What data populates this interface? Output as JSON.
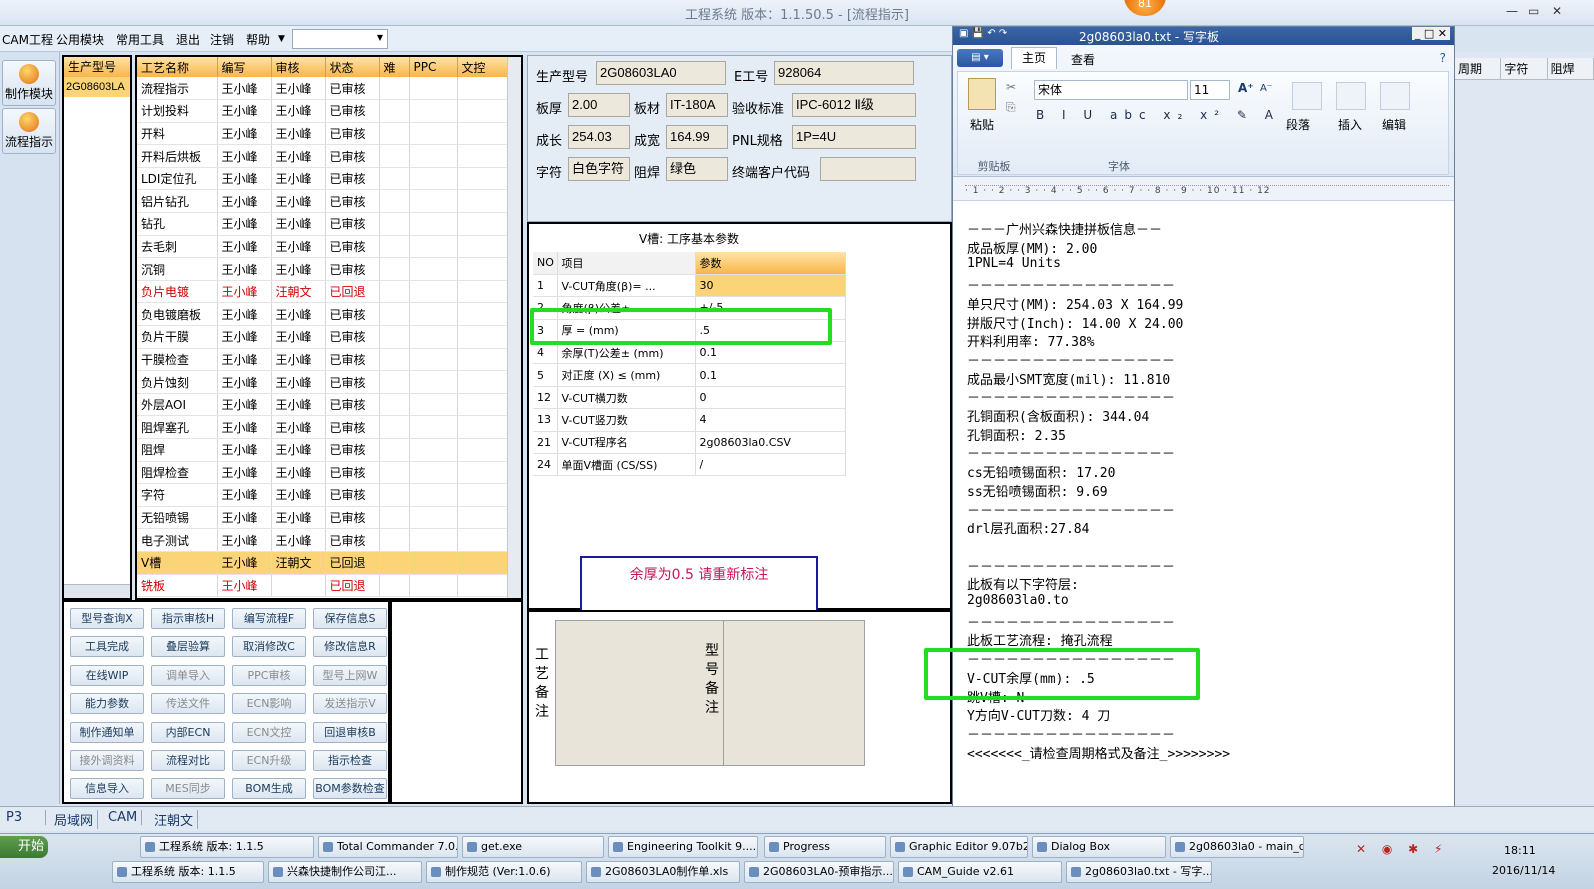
{
  "window": {
    "title": "工程系统   版本：1.1.50.5 - [流程指示]",
    "badge": "81"
  },
  "menu": [
    "CAM工程",
    "公用模块",
    "常用工具",
    "退出",
    "注销",
    "帮助"
  ],
  "leftbar": [
    {
      "label": "制作模块",
      "icon": "make-module-icon"
    },
    {
      "label": "流程指示",
      "icon": "flow-indicator-icon"
    }
  ],
  "model_panel": {
    "header": "生产型号",
    "value": "2G08603LA"
  },
  "process_table": {
    "headers": [
      "工艺名称",
      "编写",
      "审核",
      "状态",
      "难",
      "PPC",
      "文控"
    ],
    "rows": [
      [
        "流程指示",
        "王小峰",
        "王小峰",
        "已审核"
      ],
      [
        "计划投料",
        "王小峰",
        "王小峰",
        "已审核"
      ],
      [
        "开料",
        "王小峰",
        "王小峰",
        "已审核"
      ],
      [
        "开料后烘板",
        "王小峰",
        "王小峰",
        "已审核"
      ],
      [
        "LDI定位孔",
        "王小峰",
        "王小峰",
        "已审核"
      ],
      [
        "铝片钻孔",
        "王小峰",
        "王小峰",
        "已审核"
      ],
      [
        "钻孔",
        "王小峰",
        "王小峰",
        "已审核"
      ],
      [
        "去毛刺",
        "王小峰",
        "王小峰",
        "已审核"
      ],
      [
        "沉铜",
        "王小峰",
        "王小峰",
        "已审核"
      ],
      [
        "负片电镀",
        "王小峰",
        "汪朝文",
        "已回退"
      ],
      [
        "负电镀磨板",
        "王小峰",
        "王小峰",
        "已审核"
      ],
      [
        "负片干膜",
        "王小峰",
        "王小峰",
        "已审核"
      ],
      [
        "干膜检查",
        "王小峰",
        "王小峰",
        "已审核"
      ],
      [
        "负片蚀刻",
        "王小峰",
        "王小峰",
        "已审核"
      ],
      [
        "外层AOI",
        "王小峰",
        "王小峰",
        "已审核"
      ],
      [
        "阻焊塞孔",
        "王小峰",
        "王小峰",
        "已审核"
      ],
      [
        "阻焊",
        "王小峰",
        "王小峰",
        "已审核"
      ],
      [
        "阻焊检查",
        "王小峰",
        "王小峰",
        "已审核"
      ],
      [
        "字符",
        "王小峰",
        "王小峰",
        "已审核"
      ],
      [
        "无铅喷锡",
        "王小峰",
        "王小峰",
        "已审核"
      ],
      [
        "电子测试",
        "王小峰",
        "王小峰",
        "已审核"
      ],
      [
        "V槽",
        "王小峰",
        "汪朝文",
        "已回退"
      ],
      [
        "铣板",
        "王小峰",
        "",
        "已回退"
      ]
    ]
  },
  "buttons": [
    [
      "型号查询X",
      "指示审核H",
      "编写流程F",
      "保存信息S"
    ],
    [
      "工具完成",
      "叠层验算",
      "取消修改C",
      "修改信息R"
    ],
    [
      "在线WIP",
      "调单导入",
      "PPC审核",
      "型号上网W"
    ],
    [
      "能力参数",
      "传送文件",
      "ECN影响",
      "发送指示V"
    ],
    [
      "制作通知单",
      "内部ECN",
      "ECN文控",
      "回退审核B"
    ],
    [
      "接外调资料",
      "流程对比",
      "ECN升级",
      "指示检查"
    ],
    [
      "信息导入",
      "MES同步",
      "BOM生成",
      "BOM参数检查"
    ]
  ],
  "disabled_buttons": [
    "调单导入",
    "PPC审核",
    "型号上网W",
    "传送文件",
    "ECN影响",
    "发送指示V",
    "ECN文控",
    "接外调资料",
    "ECN升级",
    "MES同步"
  ],
  "info": {
    "model_label": "生产型号",
    "model": "2G08603LA0",
    "eno_label": "E工号",
    "eno": "928064",
    "thick_label": "板厚",
    "thick": "2.00",
    "mat_label": "板材",
    "mat": "IT-180A",
    "std_label": "验收标准",
    "std": "IPC-6012 Ⅱ级",
    "len_label": "成长",
    "len": "254.03",
    "wid_label": "成宽",
    "wid": "164.99",
    "pnl_label": "PNL规格",
    "pnl": "1P=4U",
    "char_label": "字符",
    "char": "白色字符",
    "mask_label": "阻焊",
    "mask": "绿色",
    "cust_label": "终端客户代码",
    "cust": ""
  },
  "vgroove": {
    "title": "V槽: 工序基本参数",
    "headers": [
      "NO",
      "项目",
      "参数"
    ],
    "rows": [
      [
        "1",
        "V-CUT角度(β)=  ...",
        "30"
      ],
      [
        "2",
        "角度(β)公差±",
        "+/-5"
      ],
      [
        "3",
        "厚 =  (mm)",
        ".5"
      ],
      [
        "4",
        "余厚(T)公差±  (mm)",
        "0.1"
      ],
      [
        "5",
        "对正度 (X) ≤ (mm)",
        "0.1"
      ],
      [
        "12",
        "V-CUT横刀数",
        "0"
      ],
      [
        "13",
        "V-CUT竖刀数",
        "4"
      ],
      [
        "21",
        "V-CUT程序名",
        "2g08603la0.CSV"
      ],
      [
        "24",
        "单面V槽面 (CS/SS)",
        "/"
      ]
    ]
  },
  "note": "余厚为0.5  请重新标注",
  "remarks": {
    "process_label": "工艺备注",
    "model_label": "型号备注"
  },
  "wordpad": {
    "title": "2g08603la0.txt - 写字板",
    "tabs": [
      "主页",
      "查看"
    ],
    "font": "宋体",
    "size": "11",
    "groups": [
      "剪贴板",
      "字体",
      "段落",
      "插入",
      "编辑"
    ],
    "paste": "粘贴",
    "lines": [
      "－－－广州兴森快捷拼板信息－－",
      "成品板厚(MM): 2.00",
      "1PNL=4 Units",
      "－－－－－－－－－－－－－－－－",
      "单只尺寸(MM): 254.03 X 164.99",
      "拼版尺寸(Inch): 14.00 X 24.00",
      "开料利用率: 77.38%",
      "－－－－－－－－－－－－－－－－",
      "成品最小SMT宽度(mil): 11.810",
      "－－－－－－－－－－－－－－－－",
      "孔铜面积(含板面积): 344.04",
      "孔铜面积: 2.35",
      "－－－－－－－－－－－－－－－－",
      "cs无铅喷锡面积: 17.20",
      "ss无铅喷锡面积: 9.69",
      "－－－－－－－－－－－－－－－－",
      "drl层孔面积:27.84",
      "",
      "－－－－－－－－－－－－－－－－",
      "此板有以下字符层:",
      "2g08603la0.to",
      "－－－－－－－－－－－－－－－－",
      "此板工艺流程: 掩孔流程",
      "－－－－－－－－－－－－－－－－",
      "V-CUT余厚(mm): .5",
      "跳V槽: N",
      "Y方向V-CUT刀数: 4 刀",
      "－－－－－－－－－－－－－－－－",
      "<<<<<<<_请检查周期格式及备注_>>>>>>>>"
    ]
  },
  "right_headers": [
    "周期",
    "字符",
    "阻焊"
  ],
  "status": [
    "P3",
    "局域网",
    "CAM",
    "汪朝文"
  ],
  "taskbar": {
    "start": "开始",
    "row1": [
      "工程系统  版本: 1.1.5",
      "Total Commander 7.0...",
      "get.exe",
      "Engineering Toolkit 9....",
      "Progress",
      "Graphic Editor 9.07b2...",
      "Dialog Box",
      "2g08603la0 - main_qa"
    ],
    "row2": [
      "工程系统  版本: 1.1.5",
      "兴森快捷制作公司江...",
      "制作规范 (Ver:1.0.6)",
      "2G08603LA0制作单.xls",
      "2G08603LA0-预审指示...",
      "CAM_Guide v2.61",
      "2g08603la0.txt - 写字..."
    ],
    "clock": "18:11",
    "date": "2016/11/14"
  }
}
